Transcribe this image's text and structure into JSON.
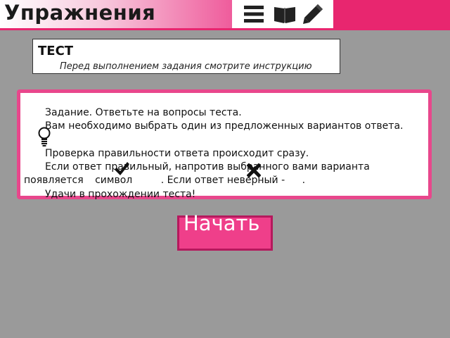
{
  "header": {
    "title": "Упражнения",
    "icons": [
      "menu-icon",
      "book-icon",
      "pencil-icon"
    ],
    "colors": {
      "accent": "#e8266f",
      "panel_border": "#e8478c",
      "background": "#9a9a9a"
    }
  },
  "test": {
    "title": "ТЕСТ",
    "subtitle": "Перед выполнением задания смотрите инструкцию"
  },
  "instructions": {
    "p1": "Задание. Ответьте на вопросы теста.",
    "p2": "Вам необходимо выбрать  один из предложенных  вариантов ответа.",
    "p3": "Проверка правильности ответа происходит сразу.",
    "p4a": "Если ответ правильный,   напротив выбранного вами варианта появляется",
    "p4b": "символ",
    "p4c": ". Если ответ неверный  -",
    "p4d": ".",
    "p5": "Удачи в прохождении теста!",
    "icons": [
      "lightbulb-icon",
      "checkmark-icon",
      "cross-icon"
    ]
  },
  "start_button": {
    "label": "Начать"
  }
}
